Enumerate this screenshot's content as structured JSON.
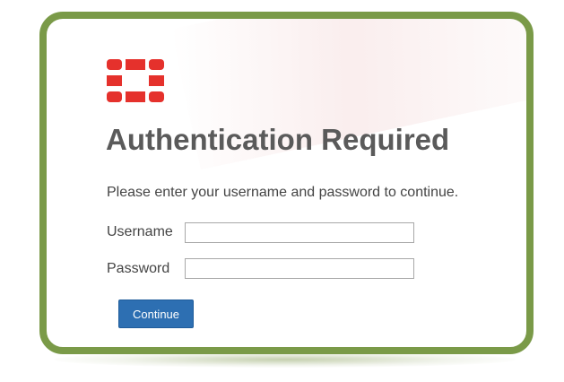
{
  "brand": {
    "logo_icon": "fortinet-logo-icon",
    "logo_color": "#e5312c",
    "frame_color": "#7a9a48"
  },
  "page": {
    "title": "Authentication Required",
    "subtitle": "Please enter your username and password to continue."
  },
  "form": {
    "username_label": "Username",
    "username_value": "",
    "password_label": "Password",
    "password_value": "",
    "submit_label": "Continue",
    "submit_color": "#2d6fb2"
  }
}
